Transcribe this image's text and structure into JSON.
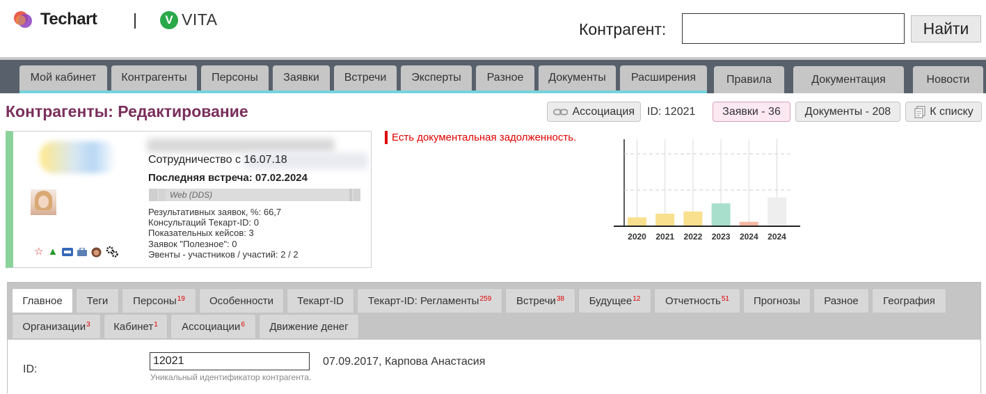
{
  "header": {
    "brand_techart": "Techart",
    "brand_vita": "VITA",
    "brand_vita_letter": "V",
    "search_label": "Контрагент:",
    "search_value": "",
    "search_button": "Найти"
  },
  "nav": {
    "tabs": [
      "Мой кабинет",
      "Контрагенты",
      "Персоны",
      "Заявки",
      "Встречи",
      "Эксперты",
      "Разное",
      "Документы",
      "Расширения"
    ],
    "right_tabs": [
      "Правила",
      "Документация",
      "Новости"
    ]
  },
  "page": {
    "title": "Контрагенты: Редактирование",
    "association_button": "Ассоциация",
    "id_text": "ID: 12021",
    "requests_button": "Заявки - 36",
    "documents_button": "Документы - 208",
    "to_list_button": "К списку"
  },
  "card": {
    "since": "Сотрудничество с 16.07.18",
    "last_meeting": "Последняя встреча: 07.02.2024",
    "web_label": "Web (DDS)",
    "stats": [
      "Результативных заявок, %: 66,7",
      "Консультаций Текарт-ID: 0",
      "Показательных кейсов: 3",
      "Заявок \"Полезное\": 0",
      "Эвенты - участников / участий: 2 / 2"
    ],
    "icons": [
      "star-icon",
      "thumbs-up-icon",
      "hdr-badge-icon",
      "briefcase-icon",
      "bear-avatar-icon",
      "gears-icon"
    ],
    "colors": {
      "accent_bar": "#8ad39a"
    }
  },
  "warning": "Есть документальная задолженность.",
  "chart_data": {
    "type": "bar",
    "categories": [
      "2020",
      "2021",
      "2022",
      "2023",
      "2024",
      "2024"
    ],
    "values": [
      12,
      17,
      20,
      31,
      6,
      39
    ],
    "ylim": [
      0,
      116
    ],
    "grid": true,
    "colors": [
      "#f8e08e",
      "#f8e08e",
      "#f8e08e",
      "#a8dfcc",
      "#f6b8a4",
      "#eeeeee"
    ]
  },
  "tabs": {
    "row1": [
      {
        "label": "Главное",
        "count": ""
      },
      {
        "label": "Теги",
        "count": ""
      },
      {
        "label": "Персоны",
        "count": "19"
      },
      {
        "label": "Особенности",
        "count": ""
      },
      {
        "label": "Текарт-ID",
        "count": ""
      },
      {
        "label": "Текарт-ID: Регламенты",
        "count": "259"
      },
      {
        "label": "Встречи",
        "count": "38"
      },
      {
        "label": "Будущее",
        "count": "12"
      },
      {
        "label": "Отчетность",
        "count": "51"
      },
      {
        "label": "Прогнозы",
        "count": ""
      },
      {
        "label": "Разное",
        "count": ""
      },
      {
        "label": "География",
        "count": ""
      }
    ],
    "row2": [
      {
        "label": "Организации",
        "count": "3"
      },
      {
        "label": "Кабинет",
        "count": "1"
      },
      {
        "label": "Ассоциации",
        "count": "6"
      },
      {
        "label": "Движение денег",
        "count": ""
      }
    ]
  },
  "form": {
    "id_label": "ID:",
    "id_value": "12021",
    "id_meta": "07.09.2017, Карпова Анастасия",
    "id_hint": "Уникальный идентификатор контрагента."
  }
}
